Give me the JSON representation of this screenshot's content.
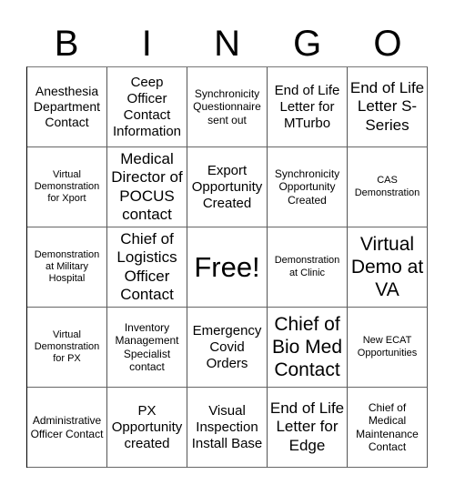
{
  "header": {
    "letters": [
      "B",
      "I",
      "N",
      "G",
      "O"
    ]
  },
  "cells": [
    "Anesthesia Department Contact",
    "Ceep Officer Contact Information",
    "Synchronicity Questionnaire sent out",
    "End of Life Letter for MTurbo",
    "End of Life Letter S- Series",
    "Virtual Demonstration for Xport",
    "Medical Director of POCUS contact",
    "Export Opportunity Created",
    "Synchronicity Opportunity Created",
    "CAS Demonstration",
    "Demonstration at Military Hospital",
    "Chief of Logistics Officer Contact",
    "Free!",
    "Demonstration at Clinic",
    "Virtual Demo at VA",
    "Virtual Demonstration for PX",
    "Inventory Management Specialist contact",
    "Emergency Covid Orders",
    "Chief of Bio Med Contact",
    "New ECAT Opportunities",
    "Administrative Officer Contact",
    "PX Opportunity created",
    "Visual Inspection Install Base",
    "End of Life Letter for Edge",
    "Chief of Medical Maintenance Contact"
  ]
}
